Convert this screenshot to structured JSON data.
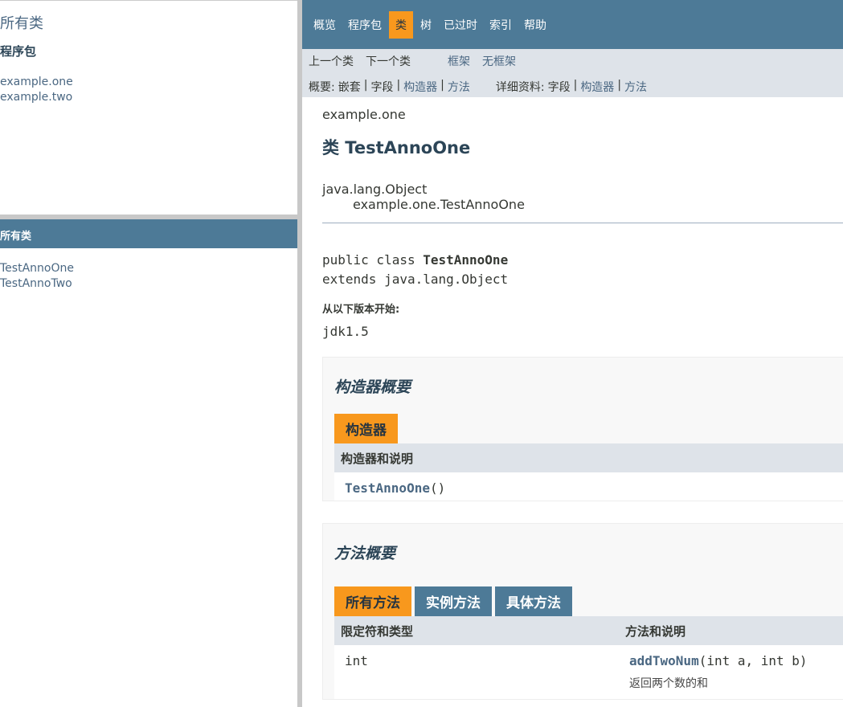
{
  "left_top": {
    "all_classes_link": "所有类",
    "packages_heading": "程序包",
    "packages": [
      "example.one",
      "example.two"
    ]
  },
  "left_bottom": {
    "heading": "所有类",
    "classes": [
      "TestAnnoOne",
      "TestAnnoTwo"
    ]
  },
  "top_nav": {
    "items": [
      "概览",
      "程序包",
      "类",
      "树",
      "已过时",
      "索引",
      "帮助"
    ],
    "active": "类"
  },
  "sub_nav": {
    "prev_class": "上一个类",
    "next_class": "下一个类",
    "frames": "框架",
    "no_frames": "无框架",
    "summary_label": "概要:",
    "summary_nested": "嵌套",
    "summary_field": "字段",
    "summary_constr": "构造器",
    "summary_method": "方法",
    "detail_label": "详细资料:",
    "detail_field": "字段",
    "detail_constr": "构造器",
    "detail_method": "方法",
    "sep": "|"
  },
  "content": {
    "package_name": "example.one",
    "class_title": "类 TestAnnoOne",
    "inherit_root": "java.lang.Object",
    "inherit_sub": "example.one.TestAnnoOne",
    "sig_prefix": "public class ",
    "sig_class": "TestAnnoOne",
    "sig_extends": "extends java.lang.Object",
    "since_label": "从以下版本开始:",
    "since_value": "jdk1.5"
  },
  "constructor_summary": {
    "title": "构造器概要",
    "tab": "构造器",
    "header": "构造器和说明",
    "ctor_name": "TestAnnoOne",
    "ctor_params": "()"
  },
  "method_summary": {
    "title": "方法概要",
    "tabs": [
      "所有方法",
      "实例方法",
      "具体方法"
    ],
    "header_type": "限定符和类型",
    "header_desc": "方法和说明",
    "row_type": "int",
    "row_method": "addTwoNum",
    "row_params": "(int a, int b)",
    "row_desc": "返回两个数的和"
  },
  "colors": {
    "nav_bg": "#4D7A97",
    "active_tab": "#F8981D",
    "subnav_bg": "#dee3e9",
    "link": "#4A6782"
  }
}
